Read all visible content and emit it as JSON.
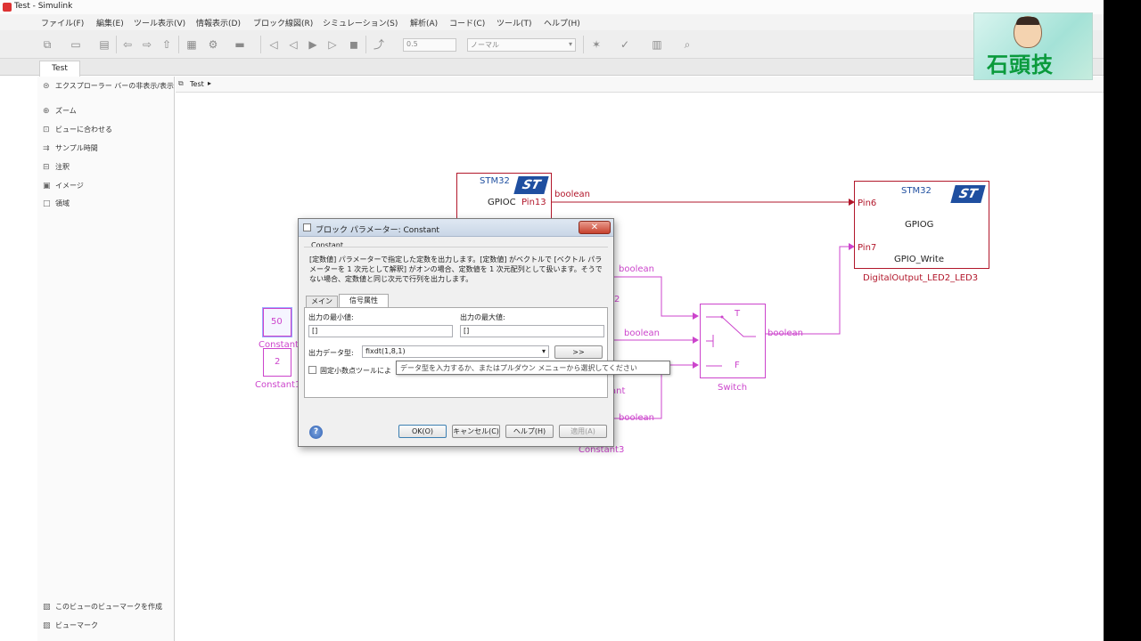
{
  "window": {
    "title": "Test - Simulink"
  },
  "menu": [
    "ファイル(F)",
    "編集(E)",
    "ツール表示(V)",
    "情報表示(D)",
    "ブロック線図(R)",
    "シミュレーション(S)",
    "解析(A)",
    "コード(C)",
    "ツール(T)",
    "ヘルプ(H)"
  ],
  "toolbar": {
    "stop_time": "0.5",
    "sim_mode": "ノーマル"
  },
  "tabs": [
    "Test"
  ],
  "sidebar": {
    "explorer_toggle": "エクスプローラー バーの非表示/表示",
    "items": [
      "ズーム",
      "ビューに合わせる",
      "サンプル時間",
      "注釈",
      "イメージ",
      "領域"
    ],
    "bottom_items": [
      "このビューのビューマークを作成",
      "ビューマーク"
    ]
  },
  "breadcrumb": {
    "path": "Test"
  },
  "canvas": {
    "gpioc_block": {
      "brand": "STM32",
      "port": "GPIOC",
      "pin": "Pin13"
    },
    "gpiog_block": {
      "brand": "STM32",
      "pin6": "Pin6",
      "port": "GPIOG",
      "pin7": "Pin7",
      "function": "GPIO_Write",
      "name": "DigitalOutput_LED2_LED3"
    },
    "switch_block": {
      "t_label": "T",
      "f_label": "F",
      "name": "Switch"
    },
    "constant_50": {
      "value": "50",
      "name": "Constant"
    },
    "constant_2": {
      "value": "2",
      "name": "Constant1"
    },
    "constant3_name": "Constant3",
    "signal_labels": [
      "boolean",
      "boolean",
      "boolean",
      "boolean",
      "boolean"
    ],
    "partial_labels": [
      "2",
      "ant"
    ]
  },
  "dialog": {
    "title": "ブロック パラメーター: Constant",
    "block_type": "Constant",
    "description": "[定数値] パラメーターで指定した定数を出力します。[定数値] がベクトルで [ベクトル パラメーターを 1 次元として解釈] がオンの場合、定数値を 1 次元配列として扱います。そうでない場合、定数値と同じ次元で行列を出力します。",
    "tabs": [
      "メイン",
      "信号属性"
    ],
    "min_label": "出力の最小値:",
    "min_value": "[]",
    "max_label": "出力の最大値:",
    "max_value": "[]",
    "datatype_label": "出力データ型:",
    "datatype_value": "fixdt(1,8,1)",
    "assistant_button": ">>",
    "checkbox_label": "固定小数点ツールによ",
    "tooltip": "データ型を入力するか、またはプルダウン メニューから選択してください",
    "buttons": {
      "ok": "OK(O)",
      "cancel": "キャンセル(C)",
      "help": "ヘルプ(H)",
      "apply": "適用(A)"
    }
  },
  "logo": {
    "text": "石頭技"
  },
  "colors": {
    "block_dark": "#b2172b",
    "block_pink": "#cc44cc",
    "st_blue": "#1f4fa0"
  }
}
